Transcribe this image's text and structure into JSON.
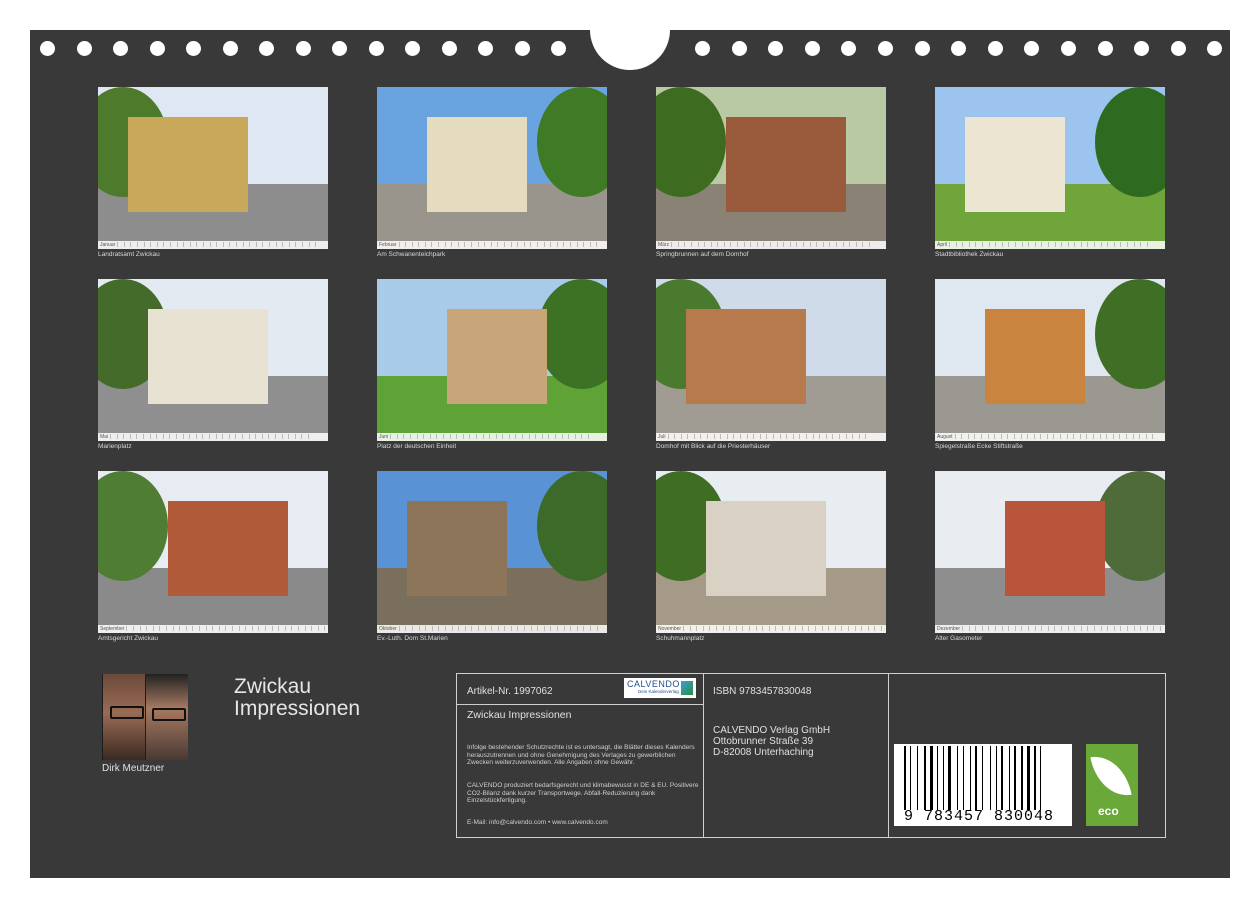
{
  "calendar_title_line1": "Zwickau",
  "calendar_title_line2": "Impressionen",
  "artist": "Dirk Meutzner",
  "photos": [
    {
      "caption": "Landratsamt Zwickau",
      "month": "Januar"
    },
    {
      "caption": "Am Schwanenteichpark",
      "month": "Februar"
    },
    {
      "caption": "Springbrunnen auf dem Domhof",
      "month": "März"
    },
    {
      "caption": "Stadtbibliothek Zwickau",
      "month": "April"
    },
    {
      "caption": "Marienplatz",
      "month": "Mai"
    },
    {
      "caption": "Platz der deutschen Einheit",
      "month": "Juni"
    },
    {
      "caption": "Domhof mit Blick auf die Priesterhäuser",
      "month": "Juli"
    },
    {
      "caption": "Spiegelstraße Ecke Stiftstraße",
      "month": "August"
    },
    {
      "caption": "Amtsgericht Zwickau",
      "month": "September"
    },
    {
      "caption": "Ev.-Luth. Dom St.Marien",
      "month": "Oktober"
    },
    {
      "caption": "Schuhmannplatz",
      "month": "November"
    },
    {
      "caption": "Alter Gasometer",
      "month": "Dezember"
    }
  ],
  "info": {
    "article": "Artikel-Nr. 1997062",
    "product_title": "Zwickau Impressionen",
    "isbn": "ISBN 9783457830048",
    "legal": "Infolge bestehender Schutzrechte ist es untersagt, die Blätter dieses Kalenders herauszutrennen und ohne Genehmigung des Verlages zu gewerblichen Zwecken weiterzuverwenden. Alle Angaben ohne Gewähr.",
    "climate": "CALVENDO produziert bedarfsgerecht und klimabewusst in DE & EU. Positivere CO2-Bilanz dank kurzer Transportwege. Abfall-Reduzierung dank Einzelstückfertigung.",
    "contact": "E-Mail: info@calvendo.com • www.calvendo.com",
    "publisher_name": "CALVENDO Verlag GmbH",
    "publisher_street": "Ottobrunner Straße 39",
    "publisher_city": "D-82008 Unterhaching",
    "logo_text": "CALVENDO",
    "logo_sub": "Dein Kalenderverlag",
    "barcode_number": "9 783457 830048",
    "eco_label": "eco"
  }
}
